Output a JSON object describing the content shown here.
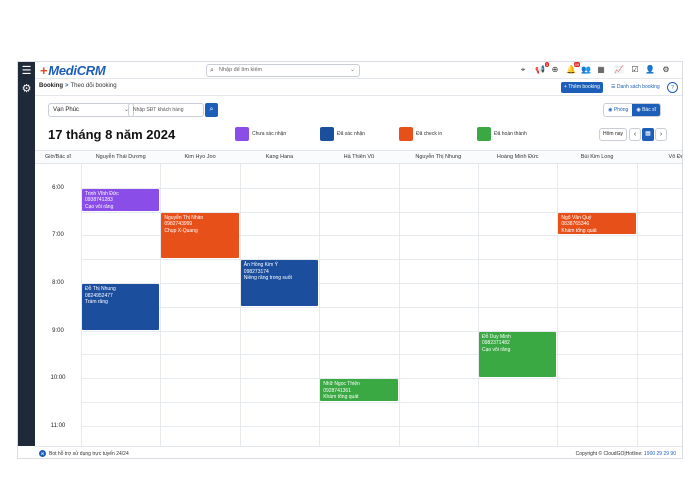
{
  "app": {
    "logo_text": "MediCRM",
    "logo_mark": "+"
  },
  "search": {
    "placeholder": "Nhập để tìm kiếm"
  },
  "topbar": {
    "icons": [
      {
        "name": "location-icon",
        "glyph": "⌖"
      },
      {
        "name": "megaphone-icon",
        "glyph": "📢",
        "badge": "3"
      },
      {
        "name": "add-circle-icon",
        "glyph": "⊕"
      },
      {
        "name": "bell-icon",
        "glyph": "🔔",
        "badge": "49"
      },
      {
        "name": "users-icon",
        "glyph": "👥"
      },
      {
        "name": "calendar-icon",
        "glyph": "▦"
      },
      {
        "name": "stats-icon",
        "glyph": "📈"
      },
      {
        "name": "checklist-icon",
        "glyph": "☑"
      },
      {
        "name": "user-icon",
        "glyph": "👤"
      },
      {
        "name": "settings-icon",
        "glyph": "⚙"
      }
    ]
  },
  "breadcrumb": {
    "root": "Booking",
    "separator": ">",
    "current": "Theo dõi booking"
  },
  "header_actions": {
    "add_booking": "+ Thêm booking",
    "booking_list": "Danh sách booking",
    "help": "?"
  },
  "filters": {
    "branch": "Vạn Phúc",
    "phone_placeholder": "Nhập SĐT khách hàng"
  },
  "view_toggle": {
    "room": "Phòng",
    "doctor": "Bác sĩ",
    "active": "doctor"
  },
  "date_title": "17 tháng 8 năm 2024",
  "legend": [
    {
      "label": "Chưa xác nhận",
      "color": "#8a4de8"
    },
    {
      "label": "Đã xác nhận",
      "color": "#1b4f9e"
    },
    {
      "label": "Đã check in",
      "color": "#e8501a"
    },
    {
      "label": "Đã hoàn thành",
      "color": "#3aa843"
    }
  ],
  "nav": {
    "today": "Hôm nay",
    "prev": "‹",
    "next": "›"
  },
  "calendar": {
    "corner_label": "Giờ/Bác sĩ",
    "doctors": [
      "Nguyễn Thái Dương",
      "Kim Hyo Joo",
      "Kang Hana",
      "Hà Thiên Vũ",
      "Nguyễn Thị Nhung",
      "Hoàng Minh Đức",
      "Bùi Kim Long",
      "Võ Đứ"
    ],
    "time_labels": [
      "6:00",
      "7:00",
      "8:00",
      "9:00",
      "10:00",
      "11:00"
    ],
    "start_hour": 5.5,
    "events": [
      {
        "col": 0,
        "start": 6.0,
        "end": 6.5,
        "status": "pending",
        "name": "Trịnh Vĩnh Đức",
        "phone": "0938741283",
        "service": "Cạo vôi răng"
      },
      {
        "col": 1,
        "start": 6.5,
        "end": 7.5,
        "status": "checkin",
        "name": "Nguyễn Thị Nhàn",
        "phone": "0982743999",
        "service": "Chụp X-Quang"
      },
      {
        "col": 6,
        "start": 6.5,
        "end": 7.0,
        "status": "checkin",
        "name": "Ngô Văn Quý",
        "phone": "0838765346",
        "service": "Khám tổng quát"
      },
      {
        "col": 2,
        "start": 7.5,
        "end": 8.5,
        "status": "confirmed",
        "name": "Ân Hồng Kim Ý",
        "phone": "098273174",
        "service": "Niềng răng trong suốt"
      },
      {
        "col": 0,
        "start": 8.0,
        "end": 9.0,
        "status": "confirmed",
        "name": "Đỗ Thị Nhung",
        "phone": "0824952477",
        "service": "Trám răng"
      },
      {
        "col": 5,
        "start": 9.0,
        "end": 10.0,
        "status": "done",
        "name": "Đỗ Duy Minh",
        "phone": "0982371482",
        "service": "Cạo vôi răng"
      },
      {
        "col": 3,
        "start": 10.0,
        "end": 10.5,
        "status": "done",
        "name": "Nhữ Ngọc Thiện",
        "phone": "0928741361",
        "service": "Khám tổng quát"
      }
    ]
  },
  "footer": {
    "support": "Bot hỗ trợ sử dụng trực tuyến 24/24",
    "copyright": "Copyright © CloudGO|Hotline:",
    "hotline": "1900 29 29 90"
  }
}
